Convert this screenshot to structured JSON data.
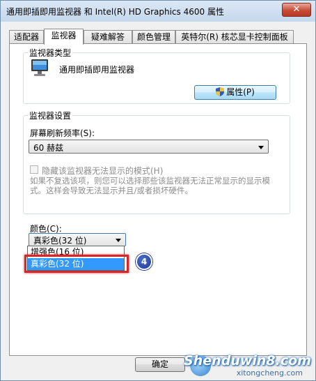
{
  "window": {
    "title": "通用即插即用监视器 和 Intel(R) HD Graphics 4600 属性",
    "close_symbol": "✕"
  },
  "tabs": [
    {
      "label": "适配器"
    },
    {
      "label": "监视器"
    },
    {
      "label": "疑难解答"
    },
    {
      "label": "颜色管理"
    },
    {
      "label": "英特尔(R) 核芯显卡控制面板"
    }
  ],
  "monitor_type": {
    "group_label": "监视器类型",
    "name": "通用即插即用监视器",
    "properties_button": "属性(P)"
  },
  "monitor_settings": {
    "group_label": "监视器设置",
    "refresh_label": "屏幕刷新频率(S):",
    "refresh_value": "60 赫兹",
    "hide_modes_label": "隐藏该监视器无法显示的模式(H)",
    "hide_modes_checked": false,
    "description": "如果不复选该项，则您可以选择那些该监视器无法正常显示的显示模式。这样会导致无法显示并且/或者损坏硬件。"
  },
  "color": {
    "label": "颜色(C):",
    "selected": "真彩色(32 位)",
    "options": [
      "增强色(16 位)",
      "真彩色(32 位)"
    ],
    "highlighted_index": 1
  },
  "annotation": {
    "step_number": "4",
    "highlight_color": "#d0282b"
  },
  "footer": {
    "ok_button": "确定"
  },
  "watermark": {
    "brand": "Shenduwin8.com",
    "sub": "xitongcheng.com"
  },
  "icons": {
    "close": "close-icon",
    "monitor": "monitor-icon",
    "shield": "uac-shield-icon",
    "dropdown": "chevron-down-icon"
  }
}
